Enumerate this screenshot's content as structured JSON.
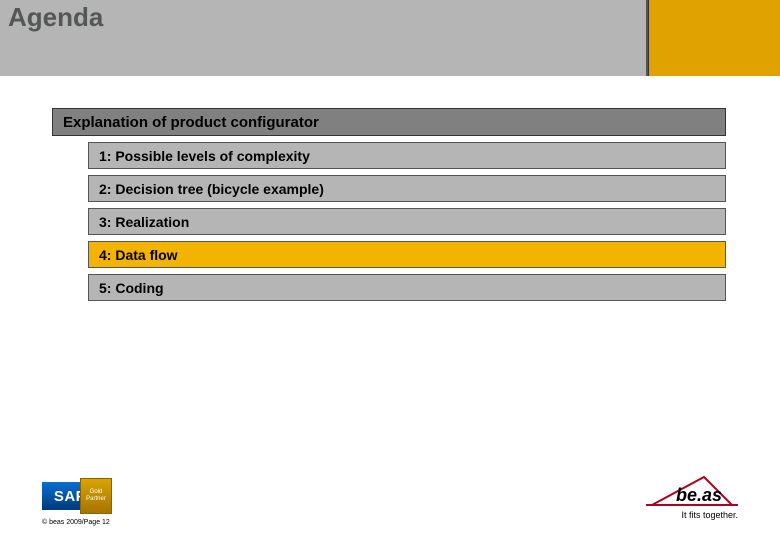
{
  "title": "Agenda",
  "section_heading": "Explanation of product configurator",
  "items": [
    {
      "label": "1: Possible levels of complexity",
      "highlight": false
    },
    {
      "label": "2: Decision tree (bicycle example)",
      "highlight": false
    },
    {
      "label": "3: Realization",
      "highlight": false
    },
    {
      "label": "4: Data flow",
      "highlight": true
    },
    {
      "label": "5: Coding",
      "highlight": false
    }
  ],
  "footer": {
    "sap_text": "SAP",
    "gold_line1": "Gold",
    "gold_line2": "Partner",
    "copyright": "© beas 2009/Page 12",
    "beas_text": "be.as",
    "tagline": "It fits together."
  },
  "colors": {
    "accent": "#e0a200",
    "highlight": "#f2b400",
    "grey_dark": "#808080",
    "grey_light": "#b6b5b5"
  }
}
